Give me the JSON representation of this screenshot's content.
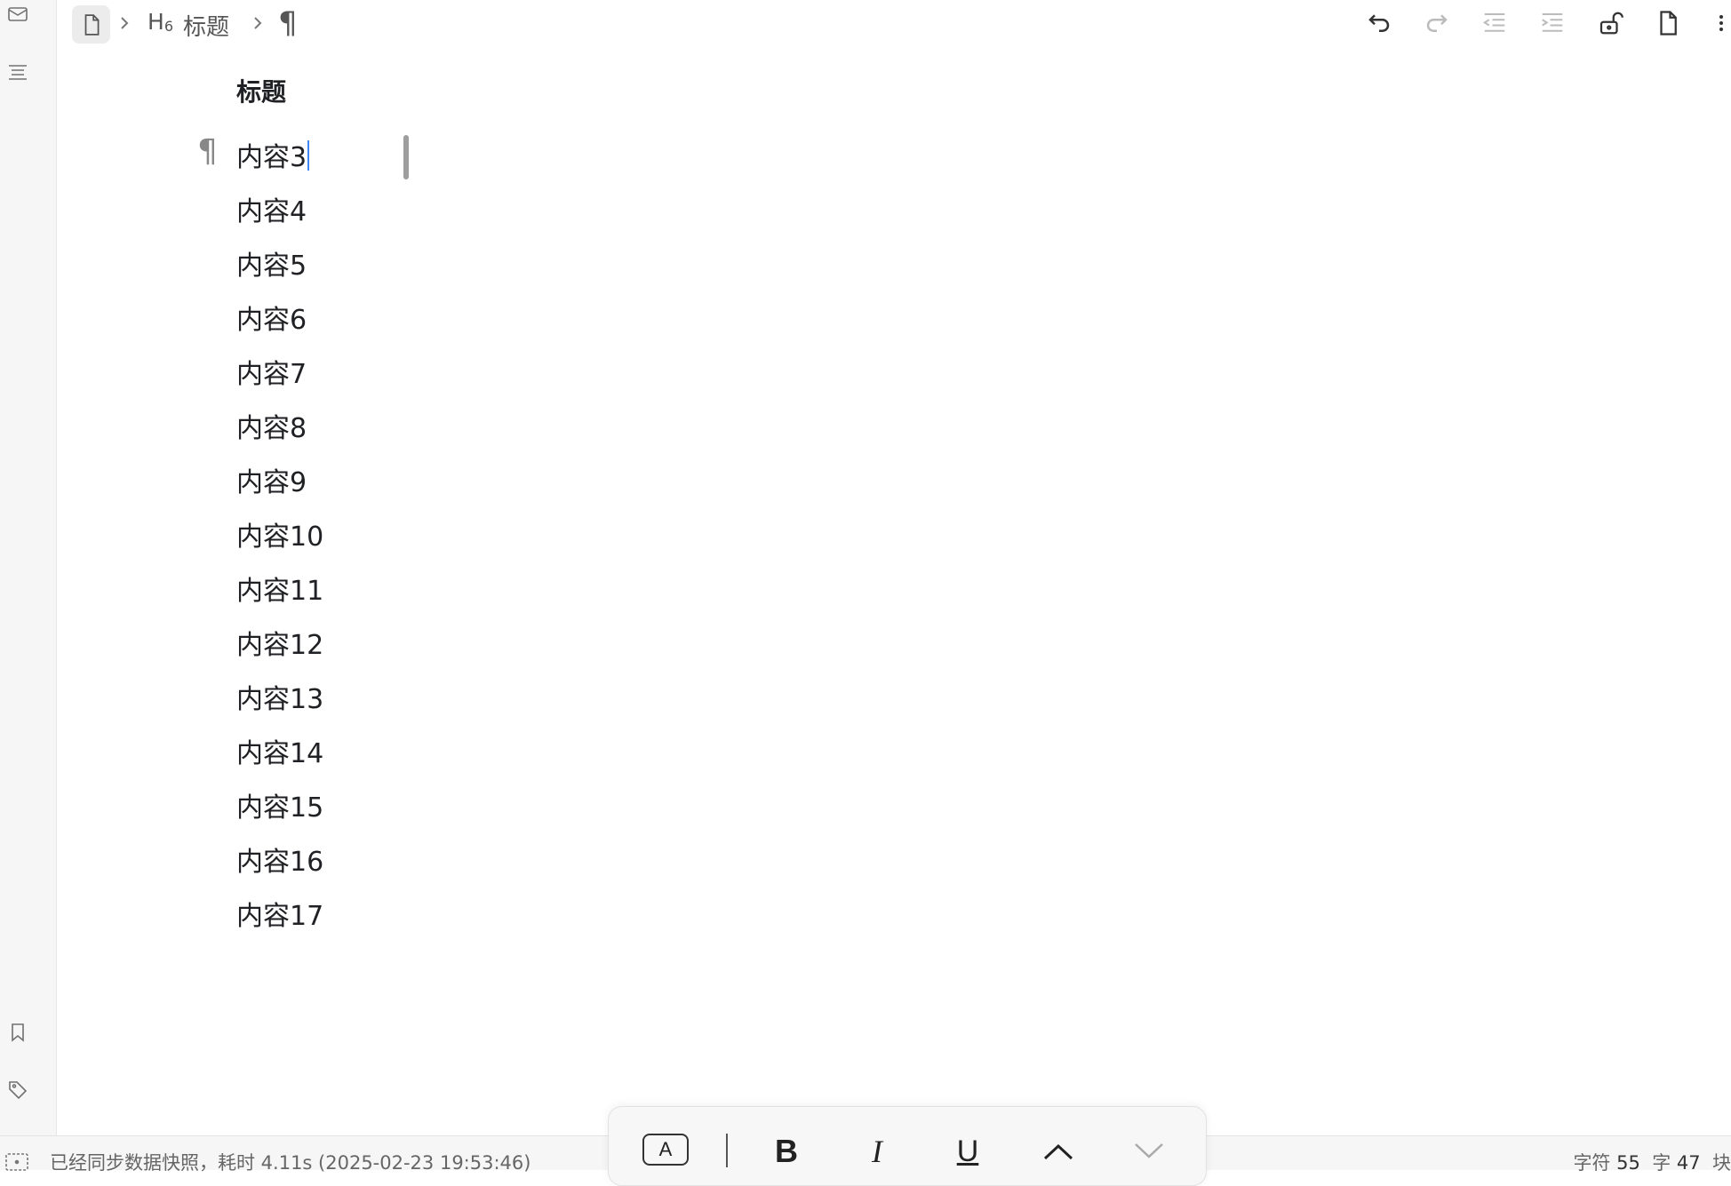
{
  "breadcrumb": {
    "heading_level": "H",
    "heading_level_num": "6",
    "heading_text": "标题",
    "block_symbol": "¶"
  },
  "document": {
    "heading": "标题",
    "paragraph_mark": "¶",
    "paragraphs": [
      "内容3",
      "内容4",
      "内容5",
      "内容6",
      "内容7",
      "内容8",
      "内容9",
      "内容10",
      "内容11",
      "内容12",
      "内容13",
      "内容14",
      "内容15",
      "内容16",
      "内容17"
    ]
  },
  "format_toolbar": {
    "font_button": "A",
    "bold": "B",
    "italic": "I",
    "underline": "U"
  },
  "status": {
    "message": "已经同步数据快照，耗时 4.11s (2025-02-23 19:53:46)",
    "chars_label": "字符",
    "chars_value": "55",
    "words_label": "字",
    "words_value": "47",
    "blocks_label": "块"
  },
  "icons": {
    "dock_top": [
      "mail-icon",
      "outline-icon"
    ],
    "dock_bottom": [
      "bookmark-icon",
      "tag-icon"
    ],
    "toolbar": [
      "undo-icon",
      "redo-icon",
      "outdent-icon",
      "indent-icon",
      "lock-icon",
      "file-icon",
      "more-icon"
    ]
  },
  "colors": {
    "caret": "#4285f4",
    "dock_bg": "#f6f6f7",
    "text": "#202124"
  }
}
